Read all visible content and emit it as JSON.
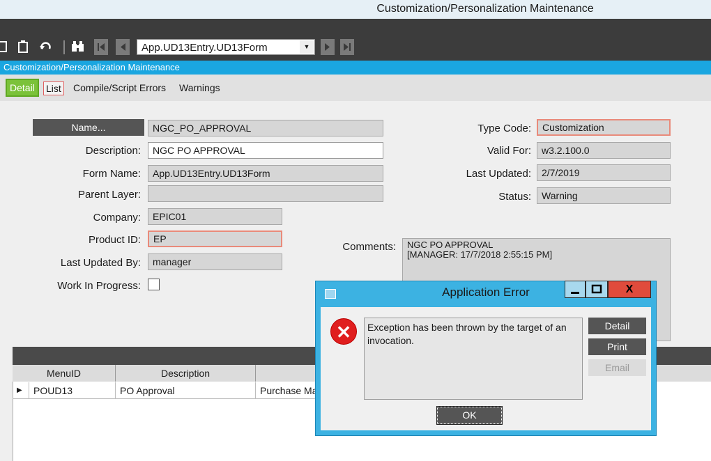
{
  "window": {
    "title": "Customization/Personalization Maintenance"
  },
  "toolbar": {
    "form_selector_value": "App.UD13Entry.UD13Form",
    "icons": [
      "save-icon",
      "clipboard-icon",
      "undo-icon",
      "binoculars-icon",
      "first-record-icon",
      "previous-record-icon",
      "dropdown-arrow-icon",
      "next-record-icon",
      "last-record-icon"
    ]
  },
  "header": {
    "title": "Customization/Personalization Maintenance"
  },
  "tabs": [
    {
      "label": "Detail"
    },
    {
      "label": "List"
    },
    {
      "label": "Compile/Script Errors"
    },
    {
      "label": "Warnings"
    }
  ],
  "form": {
    "name_button": "Name...",
    "name_value": "NGC_PO_APPROVAL",
    "description_label": "Description:",
    "description_value": "NGC PO APPROVAL",
    "form_name_label": "Form Name:",
    "form_name_value": "App.UD13Entry.UD13Form",
    "parent_layer_label": "Parent Layer:",
    "parent_layer_value": "",
    "company_label": "Company:",
    "company_value": "EPIC01",
    "product_id_label": "Product ID:",
    "product_id_value": "EP",
    "last_updated_by_label": "Last Updated By:",
    "last_updated_by_value": "manager",
    "work_in_progress_label": "Work In Progress:",
    "work_in_progress_checked": false,
    "type_code_label": "Type Code:",
    "type_code_value": "Customization",
    "valid_for_label": "Valid For:",
    "valid_for_value": "w3.2.100.0",
    "last_updated_label": "Last Updated:",
    "last_updated_value": "2/7/2019",
    "status_label": "Status:",
    "status_value": "Warning",
    "comments_label": "Comments:",
    "comments_line1": "NGC PO APPROVAL",
    "comments_line2": "[MANAGER: 17/7/2018 2:55:15 PM]"
  },
  "grid": {
    "columns": [
      "MenuID",
      "Description",
      ""
    ],
    "rows": [
      {
        "menu_id": "POUD13",
        "description": "PO Approval",
        "col3": "Purchase Ma"
      }
    ]
  },
  "dialog": {
    "title": "Application Error",
    "close_glyph": "X",
    "message": "Exception has been thrown by the target of an invocation.",
    "detail_label": "Detail",
    "print_label": "Print",
    "email_label": "Email",
    "ok_label": "OK"
  },
  "colors": {
    "header_blue": "#1aa6e0",
    "dialog_frame": "#3cb2e2",
    "detail_tab_green": "#7bc23a",
    "error_red": "#e01e1e",
    "required_border": "#e98a7a"
  }
}
